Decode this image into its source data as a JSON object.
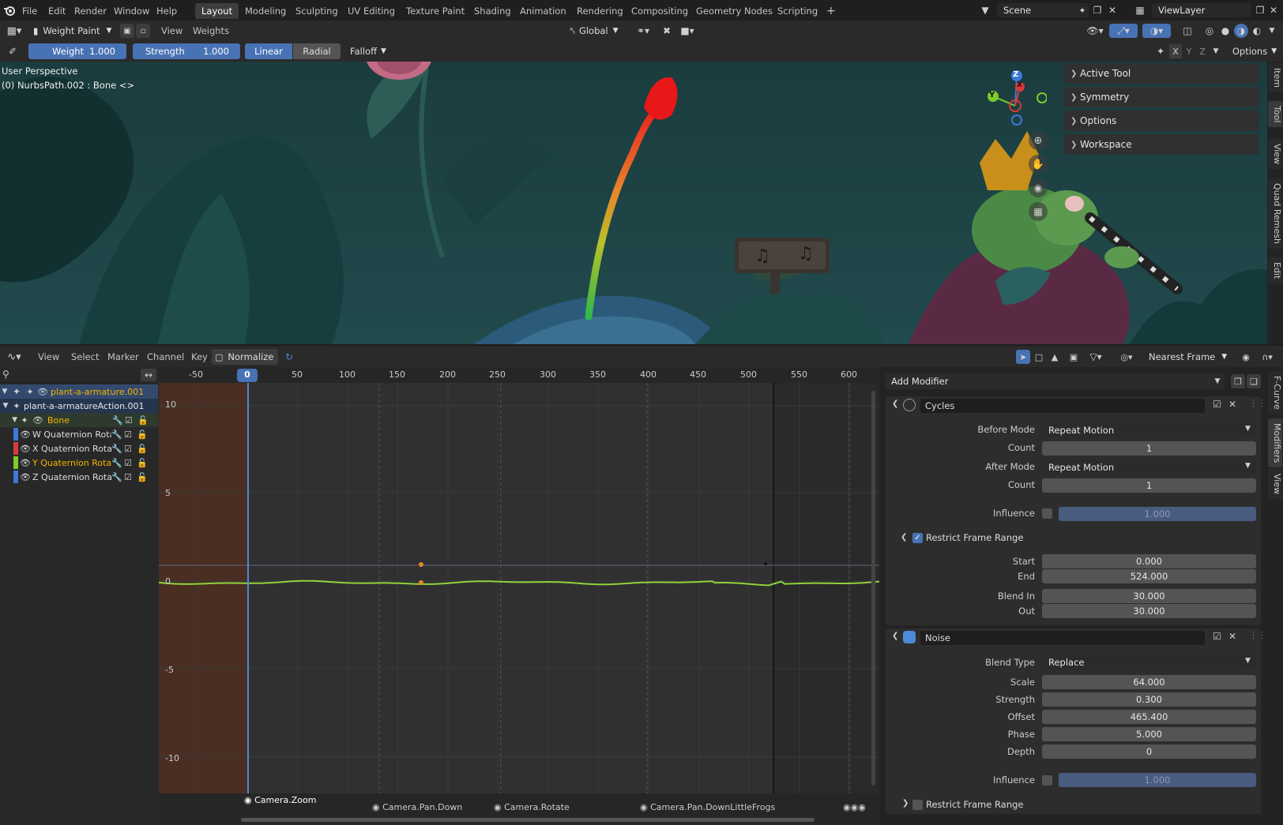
{
  "menu": {
    "items": [
      "File",
      "Edit",
      "Render",
      "Window",
      "Help"
    ],
    "workspaces": [
      "Layout",
      "Modeling",
      "Sculpting",
      "UV Editing",
      "Texture Paint",
      "Shading",
      "Animation",
      "Rendering",
      "Compositing",
      "Geometry Nodes",
      "Scripting"
    ],
    "active_workspace": "Layout",
    "add_tab": "+",
    "scene": "Scene",
    "view_layer": "ViewLayer"
  },
  "viewport_header": {
    "mode": "Weight Paint",
    "menus": [
      "View",
      "Weights"
    ],
    "orientation": "Global",
    "options": "Options"
  },
  "tool_settings": {
    "weight_label": "Weight",
    "weight_value": "1.000",
    "strength_label": "Strength",
    "strength_value": "1.000",
    "linear": "Linear",
    "radial": "Radial",
    "falloff": "Falloff",
    "axes": [
      "X",
      "Y",
      "Z"
    ]
  },
  "viewport": {
    "perspective": "User Perspective",
    "object": "(0) NurbsPath.002 : Bone <>",
    "gizmo_axes": {
      "z": "Z",
      "y": "Y",
      "x": "X"
    }
  },
  "npanel": {
    "sections": [
      "Active Tool",
      "Symmetry",
      "Options",
      "Workspace"
    ],
    "tabs": [
      "Item",
      "Tool",
      "View",
      "Quad Remesh",
      "Edit"
    ]
  },
  "graph_header": {
    "menus": [
      "View",
      "Select",
      "Marker",
      "Channel",
      "Key"
    ],
    "normalize": "Normalize",
    "snap": "Nearest Frame"
  },
  "channels": {
    "object": "plant-a-armature.001",
    "action": "plant-a-armatureAction.001",
    "group": "Bone",
    "curves": [
      {
        "name": "W Quaternion Rota",
        "color": "#3a7ad9"
      },
      {
        "name": "X Quaternion Rotat",
        "color": "#d93a3a"
      },
      {
        "name": "Y Quaternion Rotat",
        "color": "#7ccb2a"
      },
      {
        "name": "Z Quaternion Rotat",
        "color": "#3a7ad9"
      }
    ]
  },
  "timeline": {
    "current_frame": "0",
    "ticks": [
      "-50",
      "50",
      "100",
      "150",
      "200",
      "250",
      "300",
      "350",
      "400",
      "450",
      "500",
      "550",
      "600"
    ],
    "y_ticks": [
      "10",
      "5",
      "0",
      "-5",
      "-10"
    ],
    "markers": [
      "Camera.Zoom",
      "Camera.Pan.Down",
      "Camera.Rotate",
      "Camera.Pan.DownLittleFrogs"
    ]
  },
  "modifiers": {
    "add_modifier": "Add Modifier",
    "tabs": [
      "F-Curve",
      "Modifiers",
      "View"
    ],
    "cycles": {
      "name": "Cycles",
      "before_mode_label": "Before Mode",
      "before_mode": "Repeat Motion",
      "count_label": "Count",
      "before_count": "1",
      "after_mode_label": "After Mode",
      "after_mode": "Repeat Motion",
      "after_count": "1",
      "influence_label": "Influence",
      "influence": "1.000",
      "restrict_label": "Restrict Frame Range",
      "start_label": "Start",
      "start": "0.000",
      "end_label": "End",
      "end": "524.000",
      "blend_in_label": "Blend In",
      "blend_in": "30.000",
      "out_label": "Out",
      "blend_out": "30.000"
    },
    "noise": {
      "name": "Noise",
      "blend_type_label": "Blend Type",
      "blend_type": "Replace",
      "scale_label": "Scale",
      "scale": "64.000",
      "strength_label": "Strength",
      "strength": "0.300",
      "offset_label": "Offset",
      "offset": "465.400",
      "phase_label": "Phase",
      "phase": "5.000",
      "depth_label": "Depth",
      "depth": "0",
      "influence_label": "Influence",
      "influence": "1.000",
      "restrict_label": "Restrict Frame Range"
    }
  }
}
